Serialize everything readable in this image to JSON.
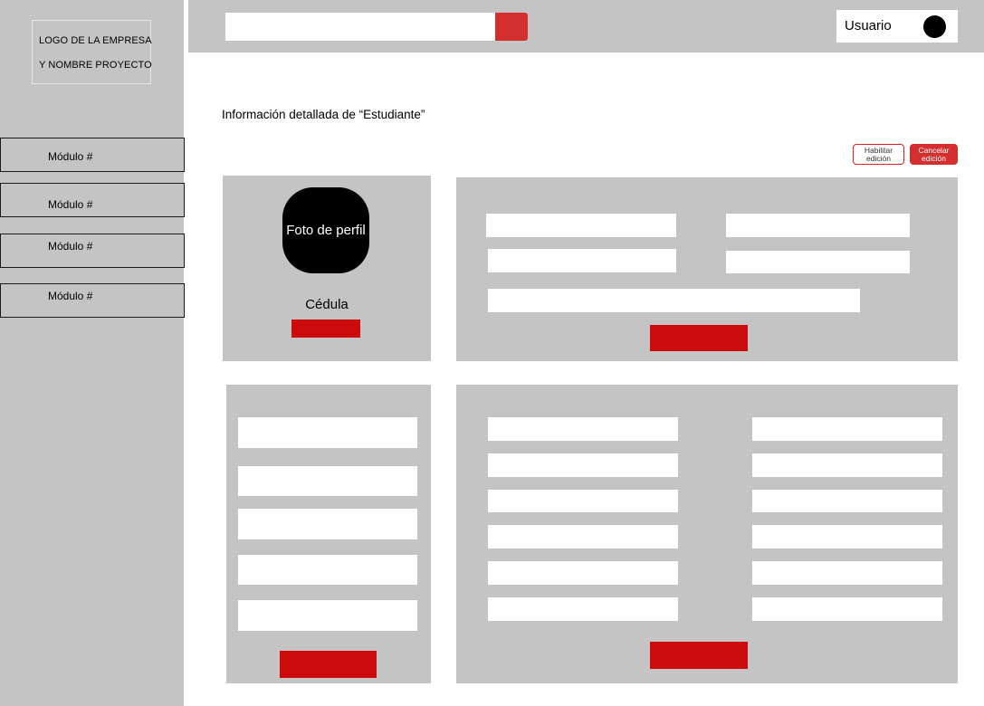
{
  "sidebar": {
    "logo_line1": "LOGO DE LA EMPRESA",
    "logo_line2": "Y NOMBRE PROYECTO",
    "items": [
      {
        "label": "Módulo #"
      },
      {
        "label": "Módulo #"
      },
      {
        "label": "Módulo #"
      },
      {
        "label": "Módulo #"
      }
    ]
  },
  "topbar": {
    "search": {
      "value": "",
      "placeholder": ""
    },
    "user_label": "Usuario"
  },
  "page": {
    "title": "Información detallada de “Estudiante”",
    "enable_edit_label": "Habilitar edición",
    "cancel_edit_label": "Cancelar edición"
  },
  "profile_card": {
    "photo_label": "Foto de perfil",
    "cedula_label": "Cédula"
  },
  "colors": {
    "sidebar_bg": "#c4c4c4",
    "accent_red": "#cc0c0c",
    "search_button": "#d42f2f",
    "panel_bg": "#c4c4c4"
  }
}
